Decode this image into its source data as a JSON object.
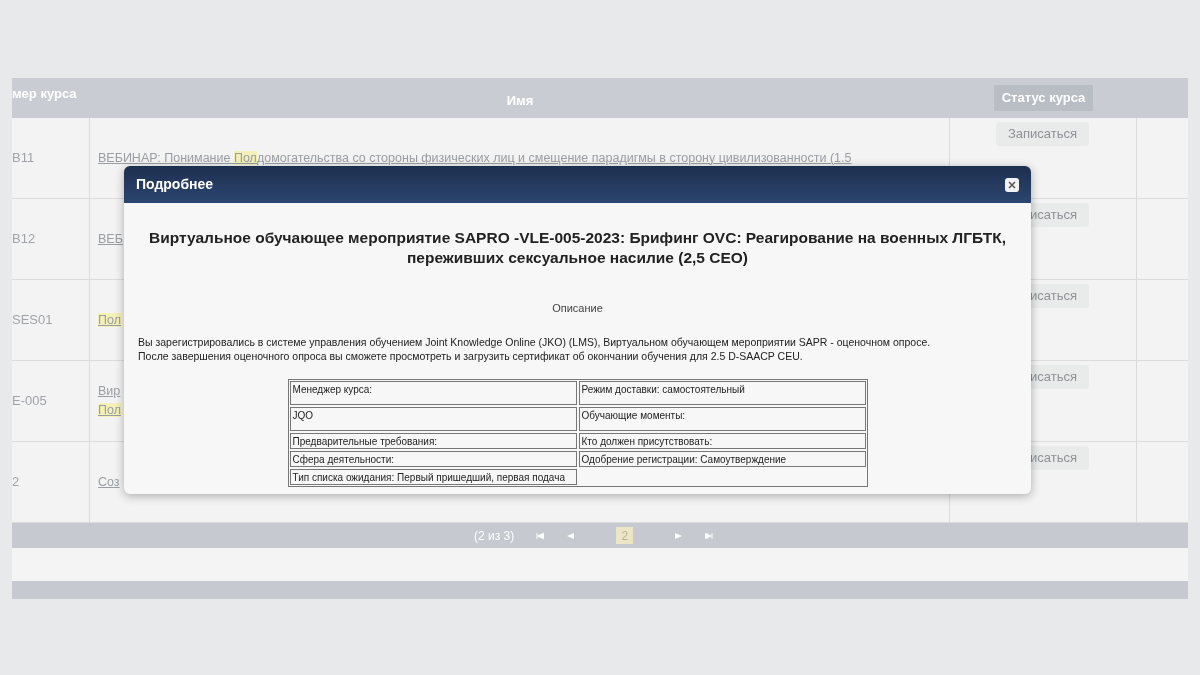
{
  "table": {
    "columns": [
      "мер курса",
      "Имя",
      "Статус курса"
    ],
    "rows": [
      {
        "code": "B11",
        "name": [
          [
            {
              "text": "ВЕБИНАР: Понимание ",
              "highlighted": false
            },
            {
              "text": "Пол",
              "highlighted": true
            },
            {
              "text": "домогательства со стороны физических лиц и смещение парадигмы в сторону цивилизованности (1.5",
              "highlighted": false
            }
          ]
        ],
        "status": "Записаться"
      },
      {
        "code": "B12",
        "name": [
          [
            {
              "text": "ВЕБ",
              "highlighted": false
            }
          ]
        ],
        "status": "исаться"
      },
      {
        "code": "SES01",
        "name": [
          [
            {
              "text": "Пол",
              "highlighted": true
            }
          ]
        ],
        "status": "исаться"
      },
      {
        "code": "E-005",
        "name": [
          [
            {
              "text": "Вир",
              "highlighted": false
            }
          ],
          [
            {
              "text": "Пол",
              "highlighted": true
            }
          ]
        ],
        "status": "исаться"
      },
      {
        "code": "2",
        "name": [
          [
            {
              "text": "Соз",
              "highlighted": false
            }
          ]
        ],
        "status": "исаться"
      }
    ]
  },
  "pagination": {
    "summary": "(2 из 3)",
    "pages": [
      {
        "label": "2",
        "selected": true
      }
    ]
  },
  "dialog": {
    "title": "Подробнее",
    "heading": "Виртуальное обучающее мероприятие SAPRO -VLE-005-2023: Брифинг OVC: Реагирование на военных ЛГБТК, переживших сексуальное насилие (2,5 CEO)",
    "section": "Описание",
    "text": [
      "Вы зарегистрировались в системе управления обучением Joint Knowledge Online (JKO) (LMS), Виртуальном обучающем мероприятии SAPR - оценочном опросе.",
      "После завершения оценочного опроса вы сможете просмотреть и загрузить сертификат об окончании обучения для 2.5 D-SAACP CEU."
    ],
    "details": [
      {
        "left": "Менеджер курса:",
        "right": "Режим доставки: самостоятельный"
      },
      {
        "left": "JQO",
        "right": "Обучающие моменты:"
      },
      {
        "left": "Предварительные требования:",
        "right": "Кто должен присутствовать:"
      },
      {
        "left": "Сфера деятельности:",
        "right": "Одобрение регистрации: Самоутверждение"
      },
      {
        "left": "Тип списка ожидания: Первый пришедший, первая подача"
      }
    ]
  }
}
